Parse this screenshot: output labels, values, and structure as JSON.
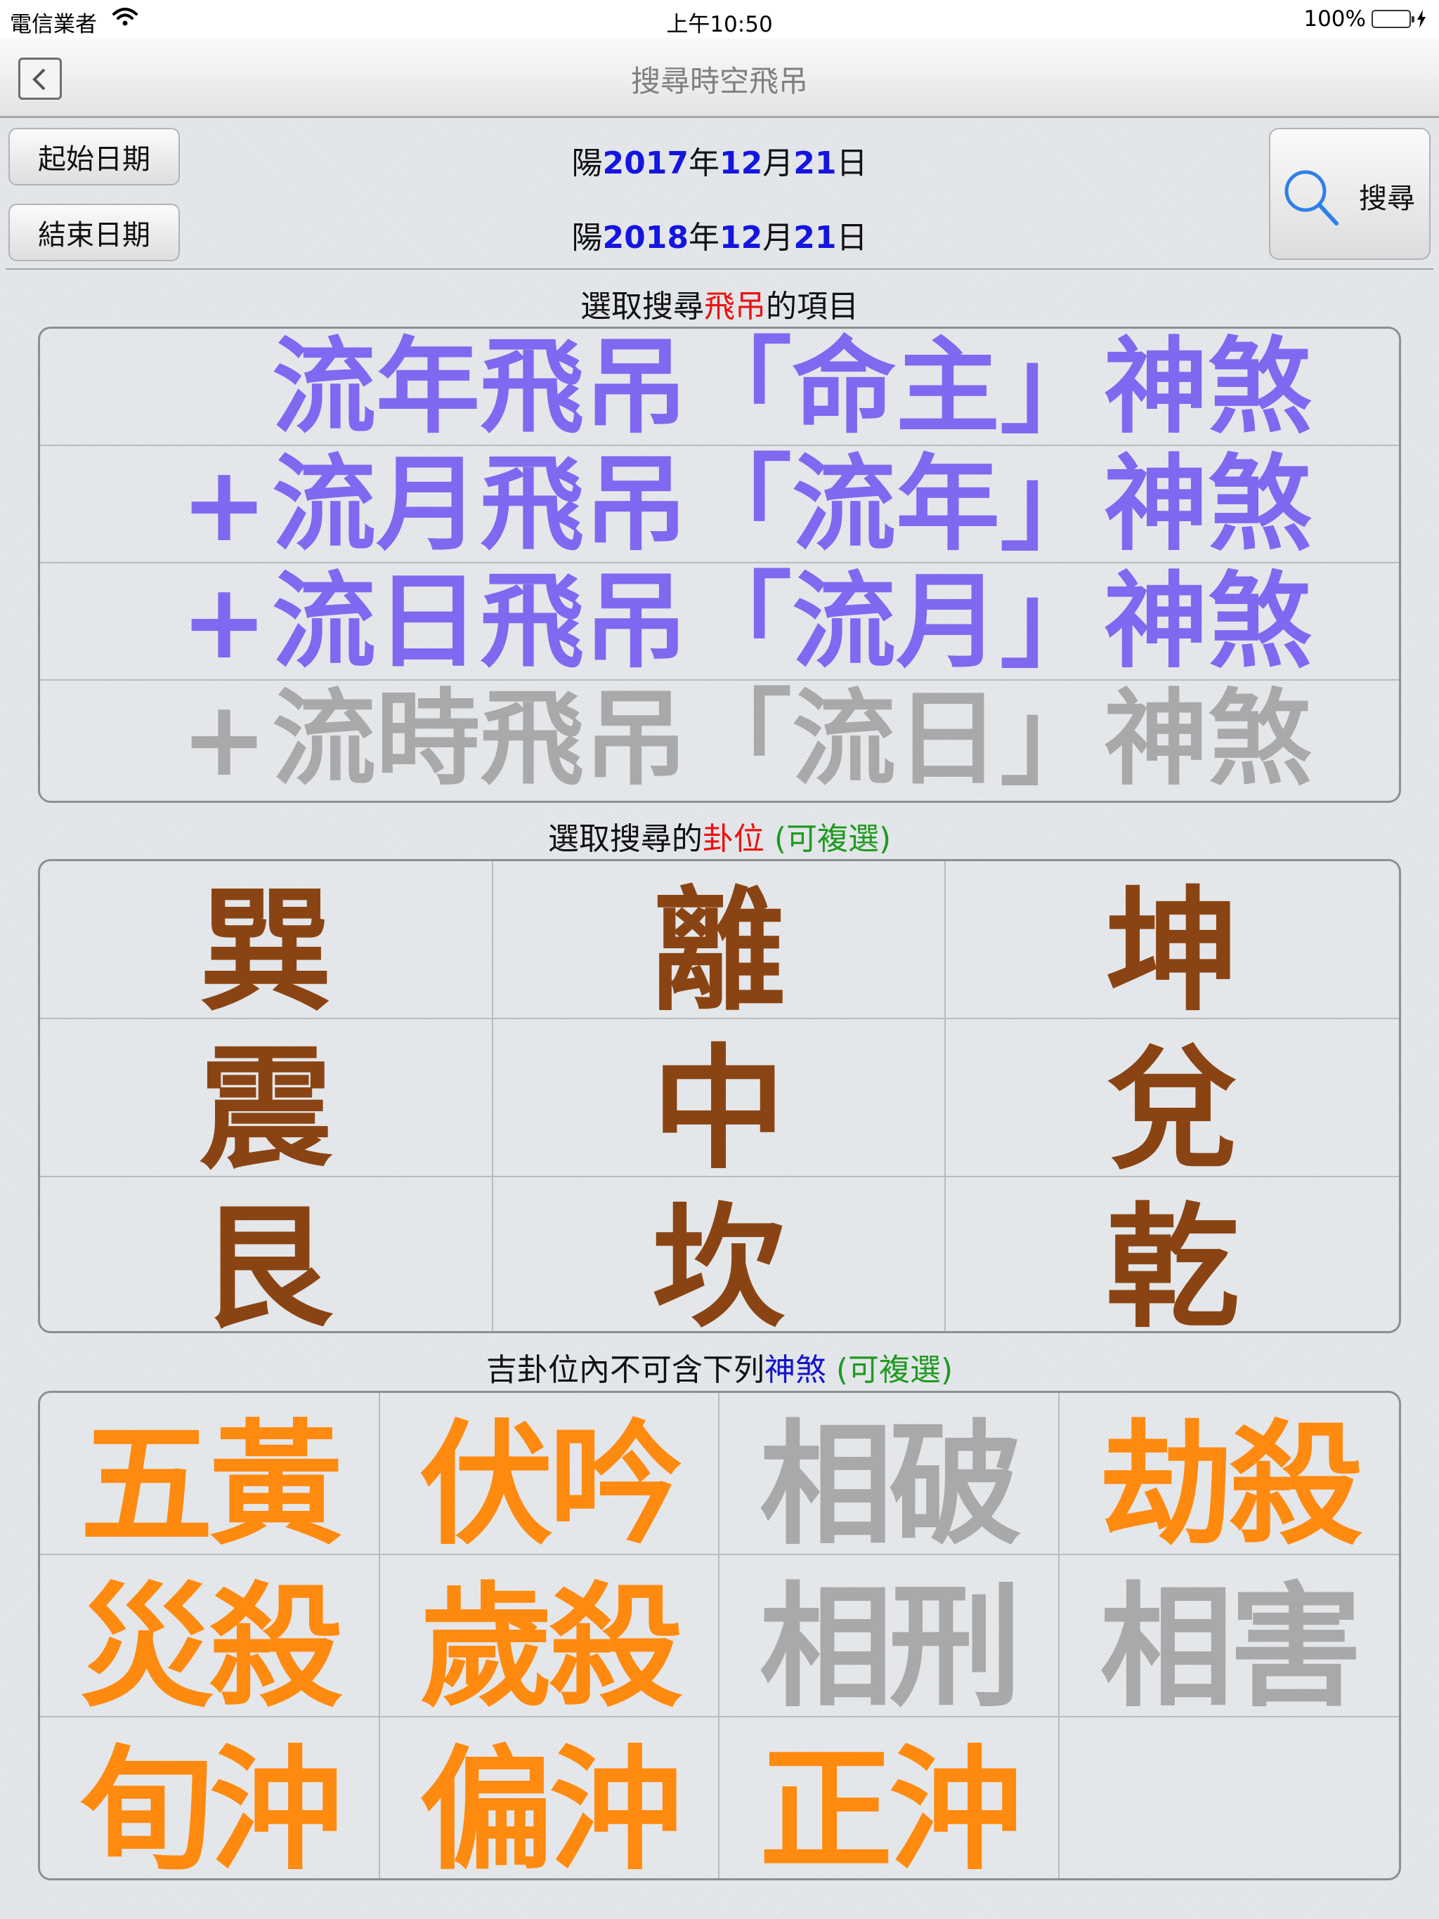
{
  "status": {
    "carrier": "電信業者",
    "time": "上午10:50",
    "battery": "100%",
    "battery_level": 1.0
  },
  "nav": {
    "title": "搜尋時空飛吊",
    "back_icon": "back-chevron-icon"
  },
  "dates": {
    "start_button": "起始日期",
    "end_button": "結束日期",
    "start": {
      "prefix": "陽",
      "year": "2017",
      "y": "年",
      "month": "12",
      "m": "月",
      "day": "21",
      "d": "日"
    },
    "end": {
      "prefix": "陽",
      "year": "2018",
      "y": "年",
      "month": "12",
      "m": "月",
      "day": "21",
      "d": "日"
    }
  },
  "search": {
    "label": "搜尋",
    "icon": "magnifier-icon"
  },
  "section1": {
    "pre": "選取搜尋",
    "highlight": "飛吊",
    "post": "的項目",
    "items": [
      {
        "plus": "",
        "text": "流年飛吊「命主」神煞",
        "active": true
      },
      {
        "plus": "+",
        "text": "流月飛吊「流年」神煞",
        "active": true
      },
      {
        "plus": "+",
        "text": "流日飛吊「流月」神煞",
        "active": true
      },
      {
        "plus": "+",
        "text": "流時飛吊「流日」神煞",
        "active": false
      }
    ]
  },
  "section2": {
    "pre": "選取搜尋的",
    "highlight": "卦位",
    "note": "(可複選)",
    "items": [
      "巽",
      "離",
      "坤",
      "震",
      "中",
      "兌",
      "艮",
      "坎",
      "乾"
    ]
  },
  "section3": {
    "pre": "吉卦位內不可含下列",
    "highlight": "神煞",
    "note": "(可複選)",
    "items": [
      {
        "text": "五黃",
        "state": "orange"
      },
      {
        "text": "伏吟",
        "state": "orange"
      },
      {
        "text": "相破",
        "state": "gray"
      },
      {
        "text": "劫殺",
        "state": "orange"
      },
      {
        "text": "災殺",
        "state": "orange"
      },
      {
        "text": "歲殺",
        "state": "orange"
      },
      {
        "text": "相刑",
        "state": "gray"
      },
      {
        "text": "相害",
        "state": "gray"
      },
      {
        "text": "旬沖",
        "state": "orange"
      },
      {
        "text": "偏沖",
        "state": "orange"
      },
      {
        "text": "正沖",
        "state": "orange"
      },
      {
        "text": "",
        "state": "empty"
      }
    ]
  },
  "colors": {
    "active_item": "#8068f0",
    "inactive_item": "#a9a9a9",
    "gua": "#8a4413",
    "orange": "#ff8a10",
    "date_number": "#1515e0"
  }
}
